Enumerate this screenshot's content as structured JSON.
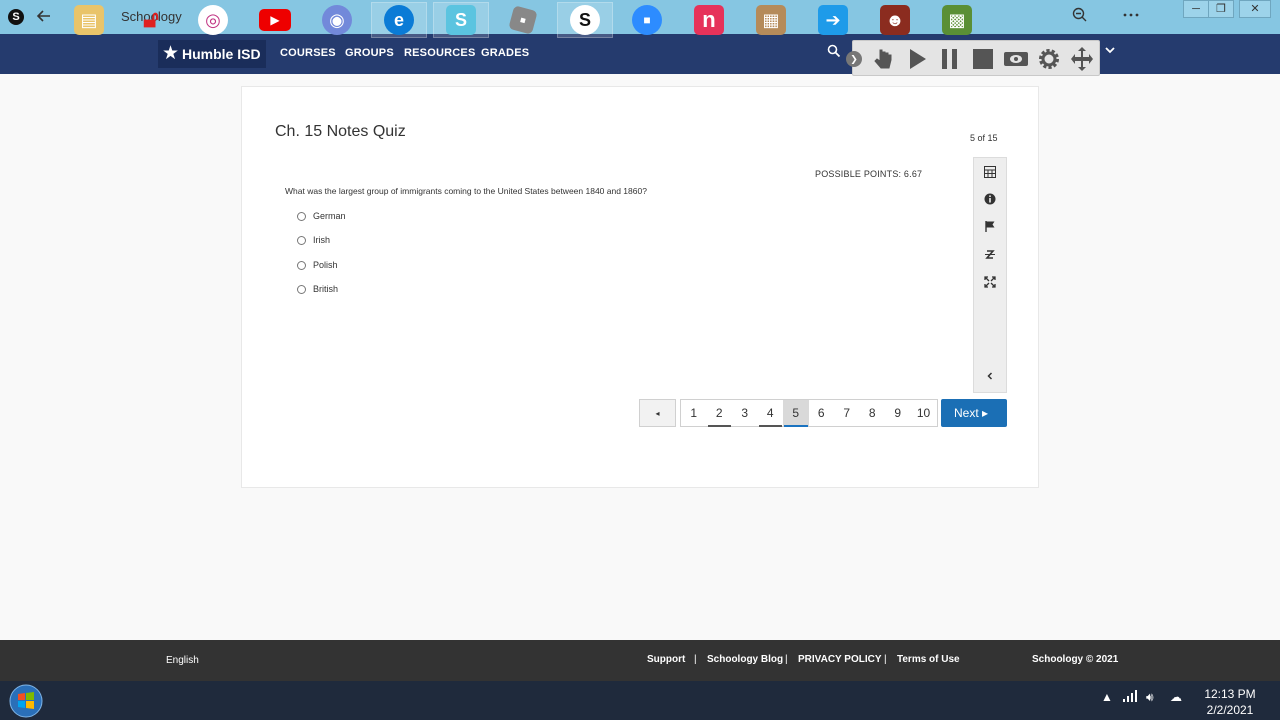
{
  "titlebar": {
    "title": "Schoology",
    "app_icon": "S"
  },
  "nav": {
    "logo": "Humble ISD",
    "links": [
      "COURSES",
      "GROUPS",
      "RESOURCES",
      "GRADES"
    ]
  },
  "quiz": {
    "title": "Ch. 15 Notes Quiz",
    "progress": "5 of 15",
    "points": "POSSIBLE POINTS: 6.67",
    "question": "What was the largest group of immigrants coming to the United States between 1840 and 1860?",
    "options": [
      "German",
      "Irish",
      "Polish",
      "British"
    ]
  },
  "pagination": {
    "prev": "◂",
    "pages": [
      "1",
      "2",
      "3",
      "4",
      "5",
      "6",
      "7",
      "8",
      "9",
      "10"
    ],
    "current_page": "5",
    "next": "Next ▸"
  },
  "footer": {
    "language": "English",
    "links": [
      "Support",
      "Schoology Blog",
      "PRIVACY POLICY",
      "Terms of Use"
    ],
    "separator": "|",
    "copyright": "Schoology © 2021"
  },
  "taskbar": {
    "time": "12:13 PM",
    "date": "2/2/2021"
  },
  "colors": {
    "titlebar": "#86c6e2",
    "navbar": "#253b6e",
    "next_button": "#1b6fb5",
    "footer": "#333333",
    "taskbar": "#1f2a3c"
  }
}
